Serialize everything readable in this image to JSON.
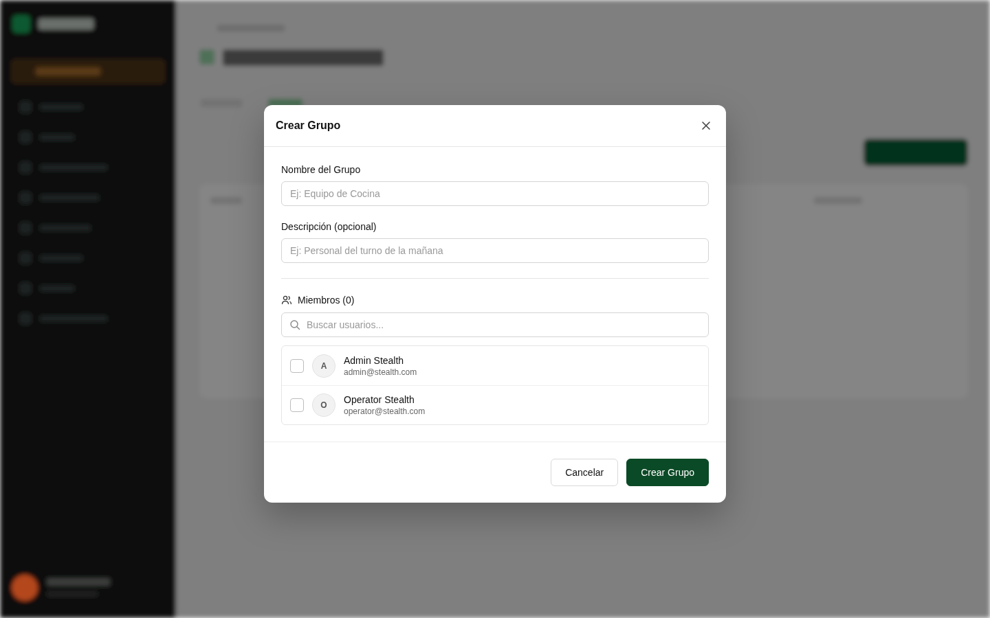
{
  "dialog": {
    "title": "Crear Grupo",
    "fields": [
      {
        "label": "Nombre del Grupo",
        "placeholder": "Ej: Equipo de Cocina"
      },
      {
        "label": "Descripción (opcional)",
        "placeholder": "Ej: Personal del turno de la mañana"
      }
    ],
    "members": {
      "label": "Miembros (0)",
      "search": {
        "placeholder": "Buscar usuarios..."
      },
      "users": [
        {
          "initial": "A",
          "name": "Admin Stealth",
          "email": "admin@stealth.com",
          "checked": false
        },
        {
          "initial": "O",
          "name": "Operator Stealth",
          "email": "operator@stealth.com",
          "checked": false
        }
      ]
    },
    "buttons": [
      {
        "label": "Cancelar",
        "kind": "secondary"
      },
      {
        "label": "Crear Grupo",
        "kind": "primary"
      }
    ]
  }
}
